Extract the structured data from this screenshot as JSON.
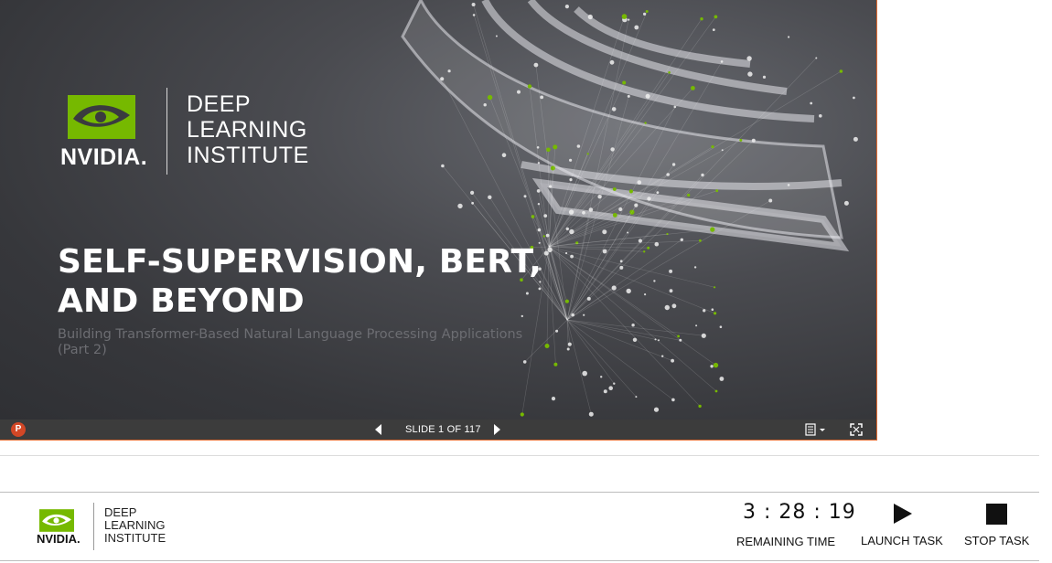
{
  "slide": {
    "logo_wordmark": "NVIDIA.",
    "logo_institute": "DEEP\nLEARNING\nINSTITUTE",
    "title": "SELF-SUPERVISION, BERT, AND BEYOND",
    "subtitle": "Building Transformer-Based Natural Language Processing Applications (Part 2)",
    "accent_color": "#76b900"
  },
  "viewer_bar": {
    "app_icon_label": "P",
    "slide_counter": "SLIDE 1 OF 117",
    "prev_icon": "triangle-left-icon",
    "next_icon": "triangle-right-icon",
    "notes_icon": "notes-icon",
    "fullscreen_icon": "fullscreen-icon"
  },
  "footer": {
    "logo_wordmark": "NVIDIA.",
    "logo_institute": "DEEP\nLEARNING\nINSTITUTE",
    "timer": "3 : 28 : 19",
    "timer_label": "REMAINING TIME",
    "launch_label": "LAUNCH TASK",
    "stop_label": "STOP TASK"
  }
}
